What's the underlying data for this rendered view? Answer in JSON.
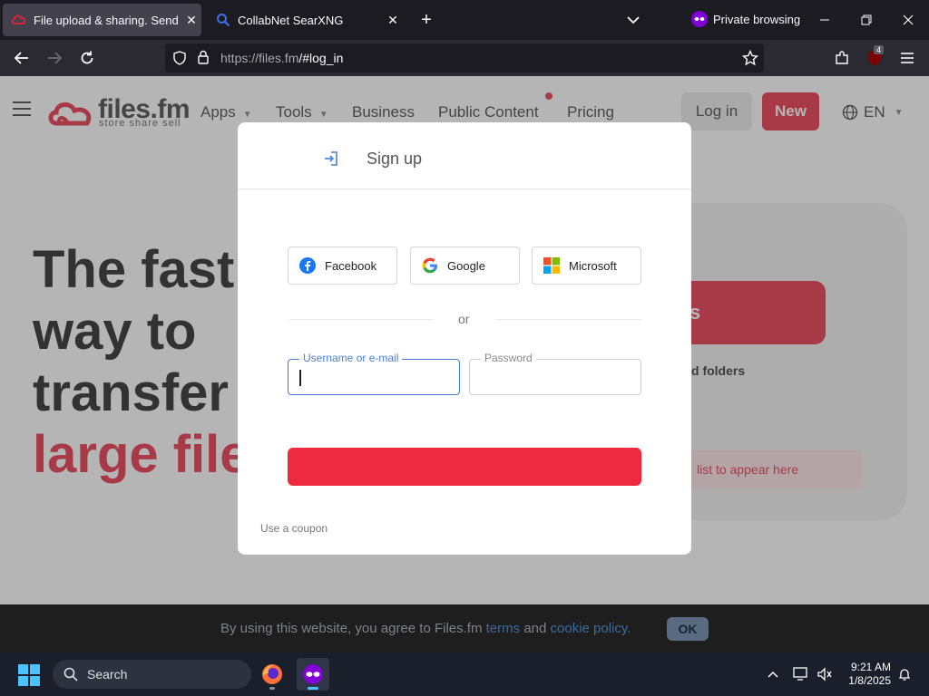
{
  "browser": {
    "tabs": [
      {
        "label": "File upload & sharing. Send larg",
        "active": true,
        "icon": "files-fm-icon"
      },
      {
        "label": "CollabNet SearXNG",
        "active": false,
        "icon": "search-icon"
      }
    ],
    "private_label": "Private browsing",
    "url_host": "https://files.fm",
    "url_path": "/#log_in",
    "extension_badge": "4"
  },
  "site": {
    "logo_text": "files.fm",
    "tagline": "store share sell",
    "nav": [
      {
        "label": "Apps",
        "has_caret": true
      },
      {
        "label": "Tools",
        "has_caret": true
      },
      {
        "label": "Business",
        "has_caret": false
      },
      {
        "label": "Public Content",
        "has_caret": false
      },
      {
        "label": "Pricing",
        "has_caret": false
      }
    ],
    "login_label": "Log in",
    "new_label": "New",
    "lang_label": "EN",
    "hero_line1": "The fast",
    "hero_line2": "way to",
    "hero_line3": "transfer",
    "hero_line4": "large file",
    "right_button_text": "s",
    "right_text": "d folders",
    "right_list_text": "list to appear here"
  },
  "modal": {
    "signup_label": "Sign up",
    "social": [
      {
        "label": "Facebook",
        "icon": "facebook-icon"
      },
      {
        "label": "Google",
        "icon": "google-icon"
      },
      {
        "label": "Microsoft",
        "icon": "microsoft-icon"
      }
    ],
    "or_text": "or",
    "username_label": "Username or e-mail",
    "username_value": "",
    "password_label": "Password",
    "password_value": "",
    "coupon_label": "Use a coupon"
  },
  "cookie": {
    "text_before": "By using this website, you agree to Files.fm",
    "terms_link": "terms",
    "and_text": "and",
    "policy_link": "cookie policy.",
    "ok_label": "OK"
  },
  "taskbar": {
    "search_label": "Search",
    "time": "9:21 AM",
    "date": "1/8/2025"
  },
  "colors": {
    "brand_red": "#e8203a",
    "focus_blue": "#4a7fd4",
    "private_purple": "#8000d7"
  }
}
